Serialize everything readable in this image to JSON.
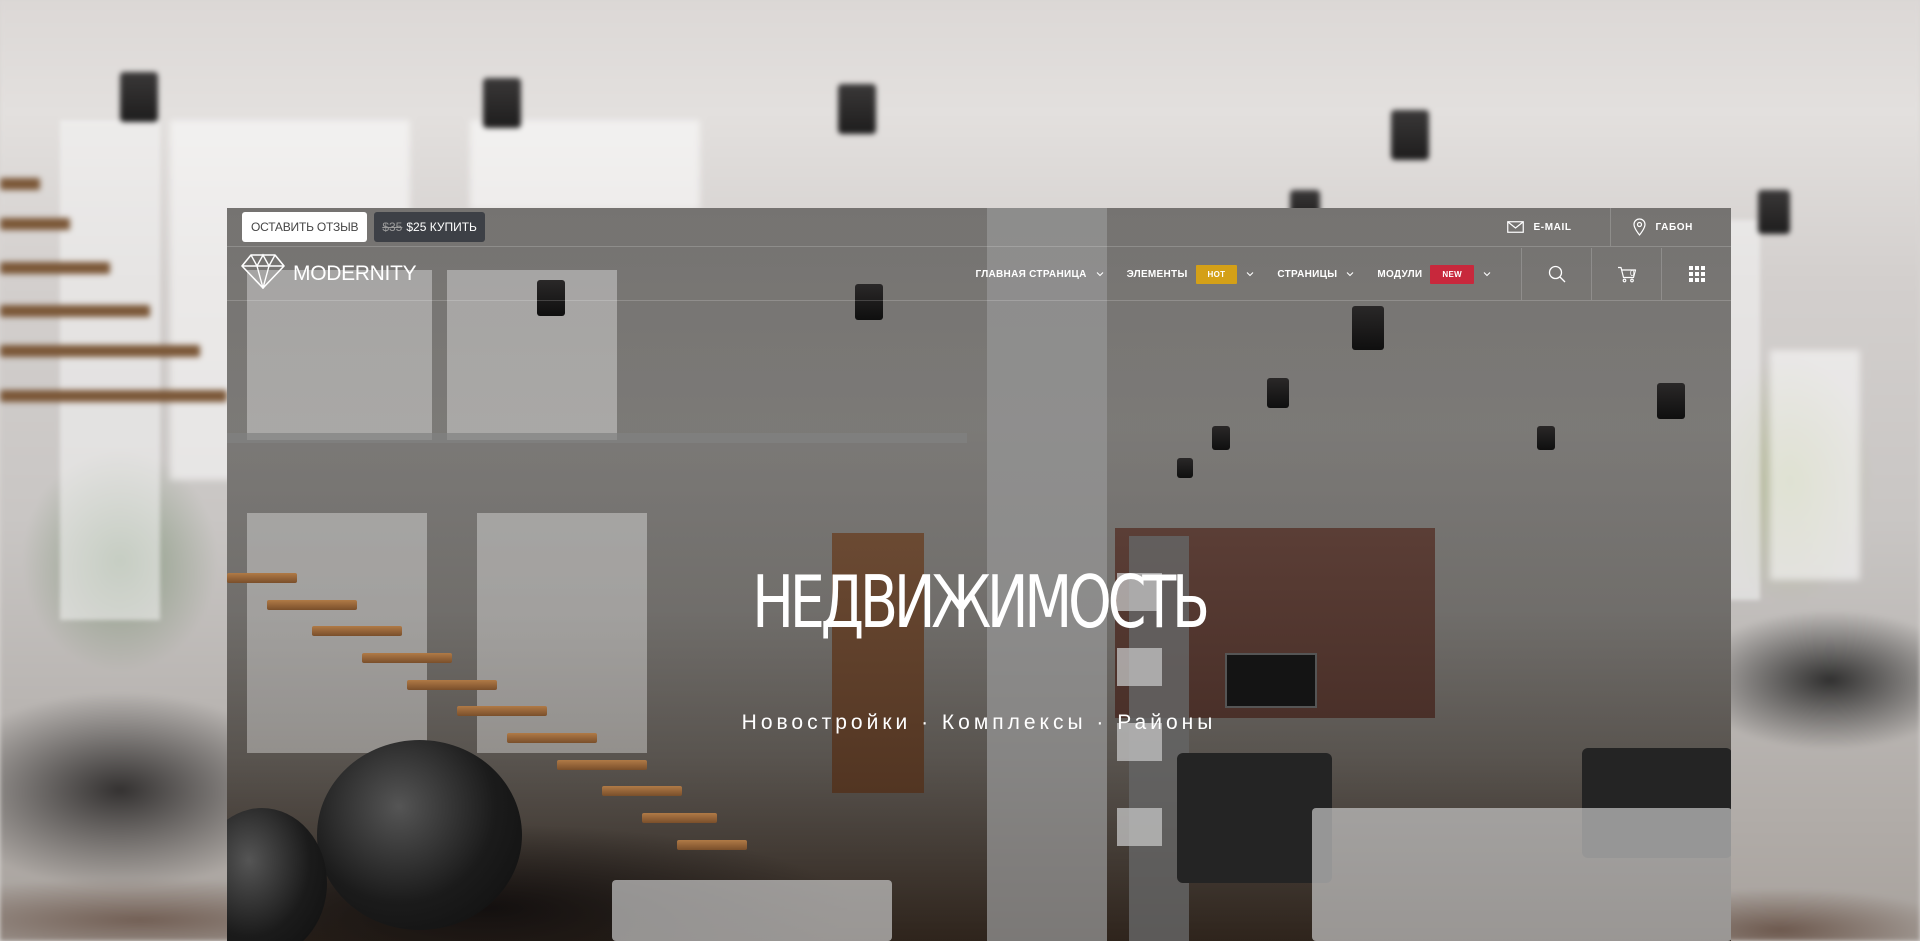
{
  "topbar": {
    "review_button": "ОСТАВИТЬ ОТЗЫВ",
    "buy_old_price": "$35",
    "buy_label": "$25 КУПИТЬ",
    "email_label": "E-MAIL",
    "email_icon": "envelope-icon",
    "location_label": "ГАБОН",
    "location_icon": "map-pin-icon"
  },
  "brand": {
    "name": "MODERNITY",
    "logo_icon": "diamond-icon"
  },
  "nav": {
    "items": [
      {
        "label": "ГЛАВНАЯ СТРАНИЦА",
        "badge": ""
      },
      {
        "label": "ЭЛЕМЕНТЫ",
        "badge": "HOT",
        "badge_color": "#d4a017"
      },
      {
        "label": "СТРАНИЦЫ",
        "badge": ""
      },
      {
        "label": "МОДУЛИ",
        "badge": "NEW",
        "badge_color": "#c8283c"
      }
    ],
    "cart_count": "0",
    "icons": [
      "search-icon",
      "cart-icon",
      "grid-menu-icon"
    ]
  },
  "hero": {
    "title": "НЕДВИЖИМОСТЬ",
    "subtitle": "Новостройки · Комплексы · Районы"
  },
  "colors": {
    "hot": "#d4a017",
    "new": "#c8283c",
    "buy_button": "#3d4046"
  }
}
